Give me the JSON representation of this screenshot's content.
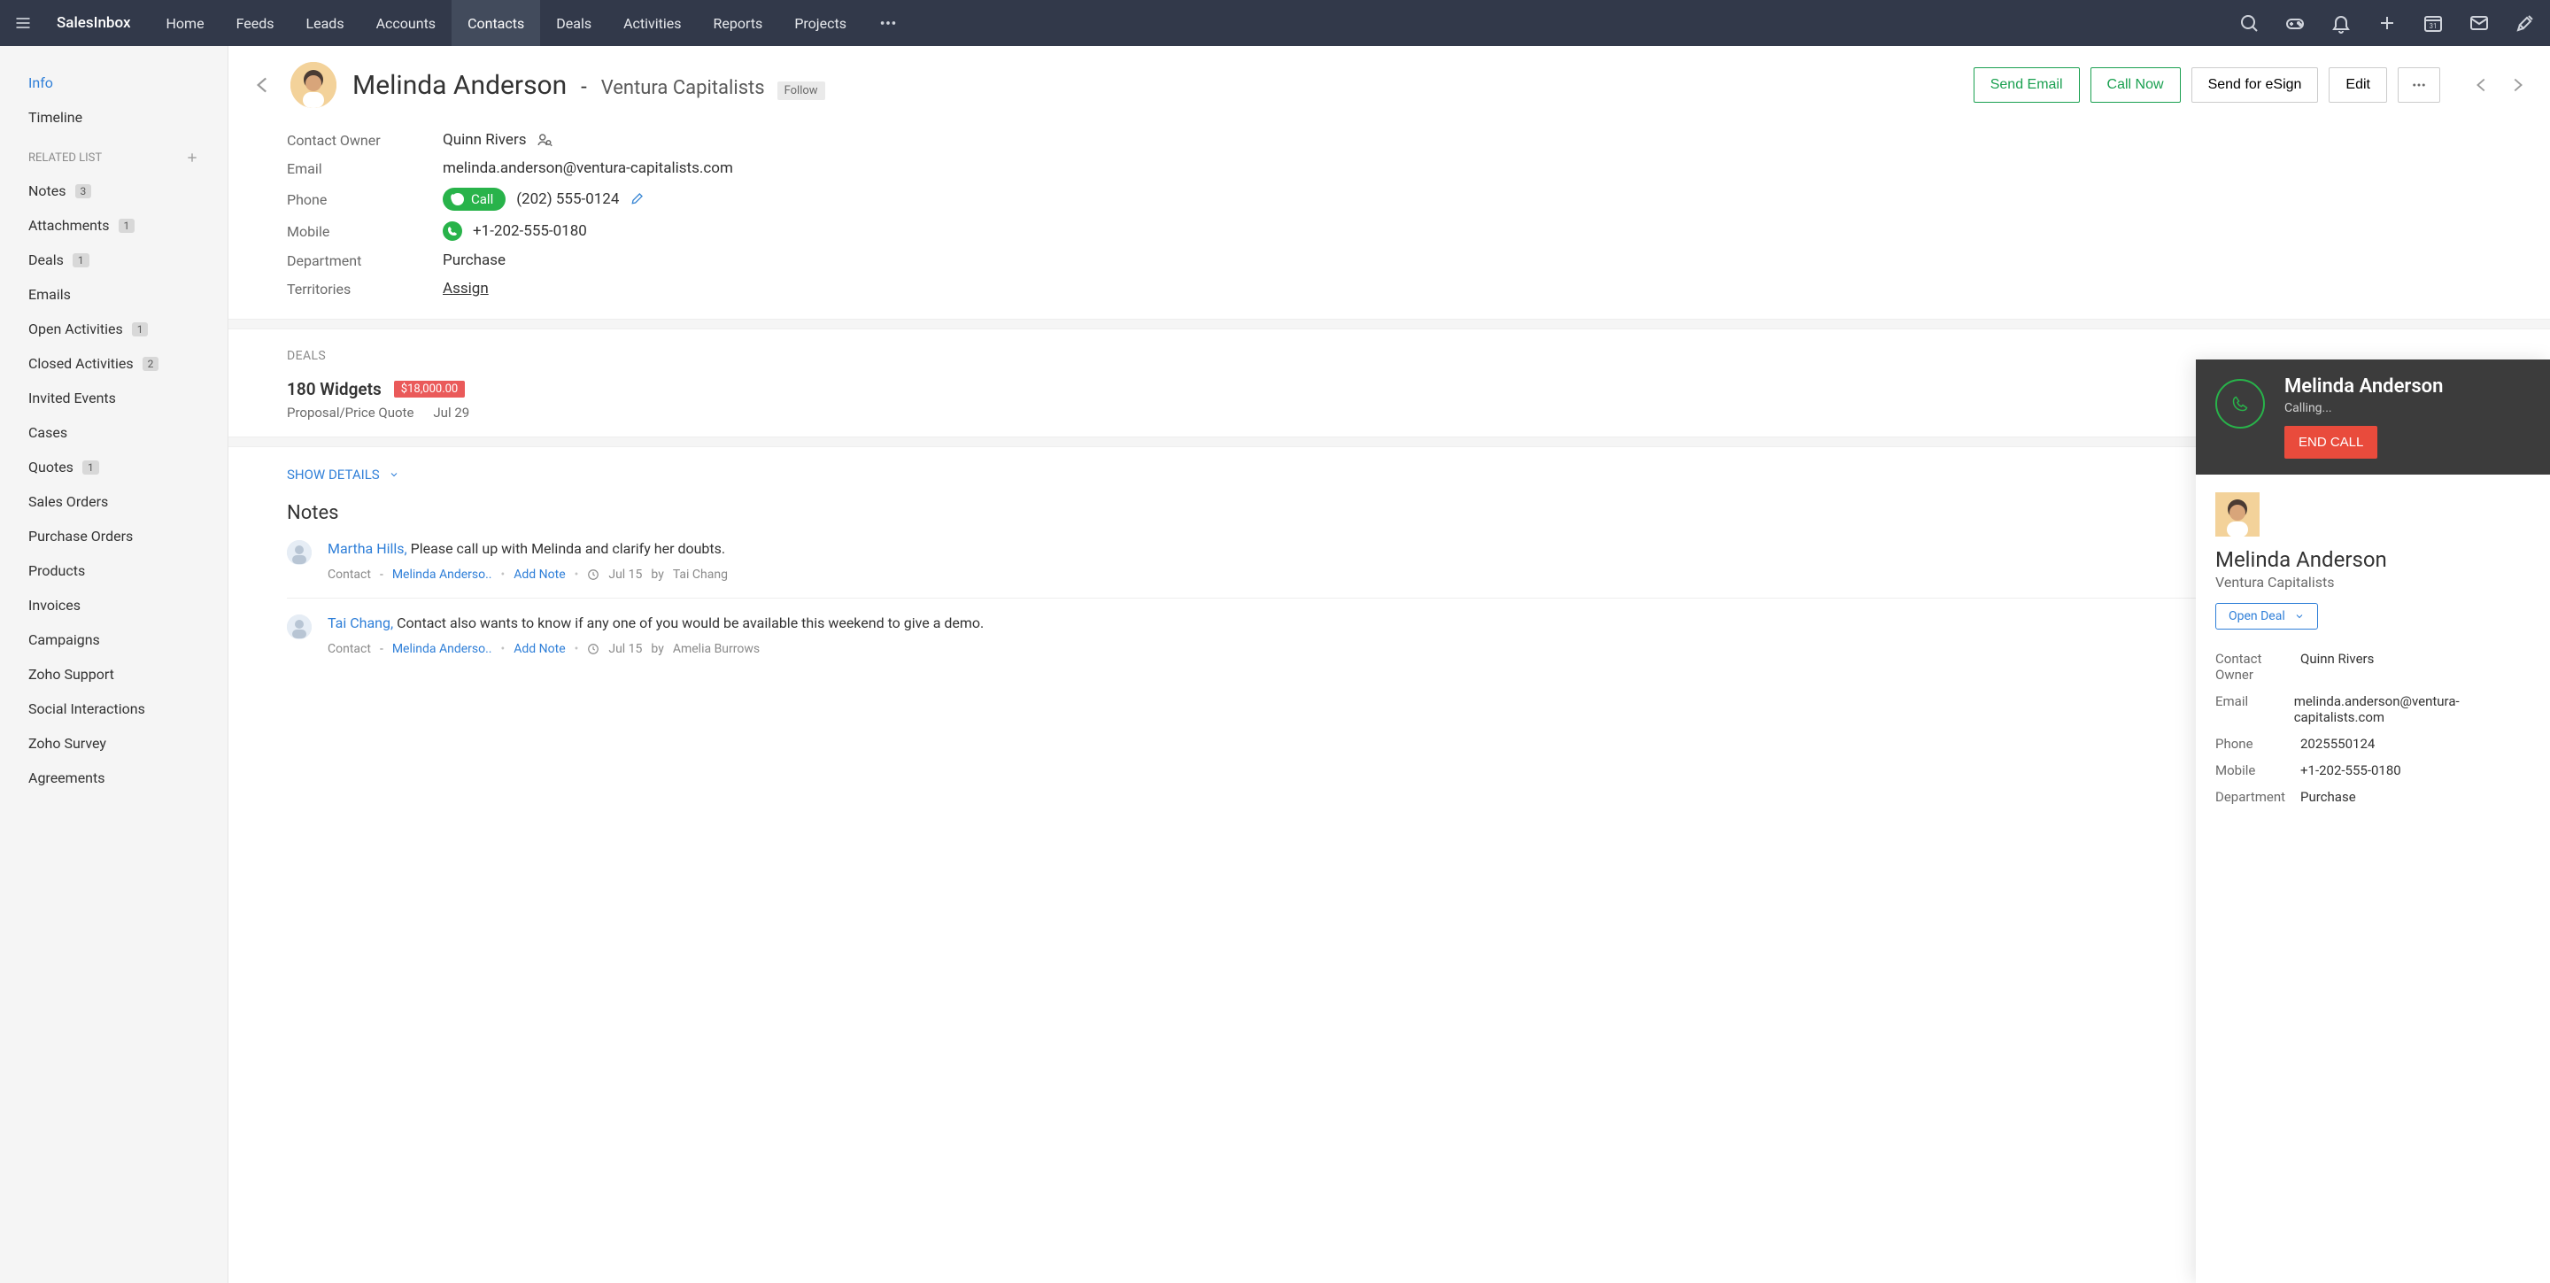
{
  "brand": "SalesInbox",
  "nav": [
    "Home",
    "Feeds",
    "Leads",
    "Accounts",
    "Contacts",
    "Deals",
    "Activities",
    "Reports",
    "Projects"
  ],
  "nav_active": "Contacts",
  "sidebar": {
    "items_top": [
      {
        "label": "Info",
        "active": true
      },
      {
        "label": "Timeline"
      }
    ],
    "related_header": "RELATED LIST",
    "related": [
      {
        "label": "Notes",
        "count": "3"
      },
      {
        "label": "Attachments",
        "count": "1"
      },
      {
        "label": "Deals",
        "count": "1"
      },
      {
        "label": "Emails"
      },
      {
        "label": "Open Activities",
        "count": "1"
      },
      {
        "label": "Closed Activities",
        "count": "2"
      },
      {
        "label": "Invited Events"
      },
      {
        "label": "Cases"
      },
      {
        "label": "Quotes",
        "count": "1"
      },
      {
        "label": "Sales Orders"
      },
      {
        "label": "Purchase Orders"
      },
      {
        "label": "Products"
      },
      {
        "label": "Invoices"
      },
      {
        "label": "Campaigns"
      },
      {
        "label": "Zoho Support"
      },
      {
        "label": "Social Interactions"
      },
      {
        "label": "Zoho Survey"
      },
      {
        "label": "Agreements"
      }
    ]
  },
  "record": {
    "name": "Melinda Anderson",
    "company": "Ventura Capitalists",
    "follow_label": "Follow",
    "actions": {
      "send_email": "Send Email",
      "call_now": "Call Now",
      "send_esign": "Send for eSign",
      "edit": "Edit"
    },
    "fields": {
      "owner_label": "Contact Owner",
      "owner": "Quinn Rivers",
      "email_label": "Email",
      "email": "melinda.anderson@ventura-capitalists.com",
      "phone_label": "Phone",
      "phone": "(202) 555-0124",
      "call_label": "Call",
      "mobile_label": "Mobile",
      "mobile": "+1-202-555-0180",
      "department_label": "Department",
      "department": "Purchase",
      "territories_label": "Territories",
      "territories": "Assign"
    }
  },
  "deals": {
    "title": "DEALS",
    "name": "180 Widgets",
    "amount": "$18,000.00",
    "stage": "Proposal/Price Quote",
    "date": "Jul 29"
  },
  "details": {
    "show_label": "SHOW DETAILS",
    "notes_title": "Notes"
  },
  "notes": [
    {
      "author": "Martha Hills,",
      "text": "Please call up with Melinda and clarify her doubts.",
      "type": "Contact",
      "related": "Melinda Anderso..",
      "addnote": "Add Note",
      "date": "Jul 15",
      "by": "by",
      "who": "Tai Chang"
    },
    {
      "author": "Tai Chang,",
      "text": "Contact also wants to know if any one of you would be available this weekend to give a demo.",
      "type": "Contact",
      "related": "Melinda Anderso..",
      "addnote": "Add Note",
      "date": "Jul 15",
      "by": "by",
      "who": "Amelia Burrows"
    }
  ],
  "call_panel": {
    "name": "Melinda Anderson",
    "status": "Calling...",
    "end": "END CALL",
    "title": "Melinda Anderson",
    "company": "Ventura Capitalists",
    "open_deal": "Open Deal",
    "fields": {
      "owner_label": "Contact Owner",
      "owner": "Quinn Rivers",
      "email_label": "Email",
      "email": "melinda.anderson@ventura-capitalists.com",
      "phone_label": "Phone",
      "phone": "2025550124",
      "mobile_label": "Mobile",
      "mobile": "+1-202-555-0180",
      "department_label": "Department",
      "department": "Purchase"
    }
  }
}
